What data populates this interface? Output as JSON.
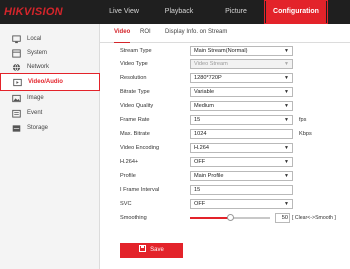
{
  "brand": {
    "logo": "HIKVISION",
    "accent": "#e3232a"
  },
  "nav": {
    "items": [
      {
        "label": "Live View",
        "active": false
      },
      {
        "label": "Playback",
        "active": false
      },
      {
        "label": "Picture",
        "active": false
      },
      {
        "label": "Configuration",
        "active": true
      }
    ]
  },
  "sidebar": {
    "items": [
      {
        "label": "Local",
        "icon": "monitor-icon",
        "active": false
      },
      {
        "label": "System",
        "icon": "system-icon",
        "active": false
      },
      {
        "label": "Network",
        "icon": "globe-icon",
        "active": false
      },
      {
        "label": "Video/Audio",
        "icon": "video-audio-icon",
        "active": true
      },
      {
        "label": "Image",
        "icon": "image-icon",
        "active": false
      },
      {
        "label": "Event",
        "icon": "event-icon",
        "active": false
      },
      {
        "label": "Storage",
        "icon": "storage-icon",
        "active": false
      }
    ]
  },
  "subtabs": [
    {
      "label": "Video",
      "active": true
    },
    {
      "label": "ROI",
      "active": false
    },
    {
      "label": "Display Info. on Stream",
      "active": false
    }
  ],
  "form": {
    "stream_type": {
      "label": "Stream Type",
      "value": "Main Stream(Normal)"
    },
    "video_type": {
      "label": "Video Type",
      "value": "Video Stream",
      "disabled": true
    },
    "resolution": {
      "label": "Resolution",
      "value": "1280*720P"
    },
    "bitrate_type": {
      "label": "Bitrate Type",
      "value": "Variable"
    },
    "video_quality": {
      "label": "Video Quality",
      "value": "Medium"
    },
    "frame_rate": {
      "label": "Frame Rate",
      "value": "15",
      "unit": "fps"
    },
    "max_bitrate": {
      "label": "Max. Bitrate",
      "value": "1024",
      "unit": "Kbps"
    },
    "video_encoding": {
      "label": "Video Encoding",
      "value": "H.264"
    },
    "h264plus": {
      "label": "H.264+",
      "value": "OFF"
    },
    "profile": {
      "label": "Profile",
      "value": "Main Profile"
    },
    "i_frame_interval": {
      "label": "I Frame Interval",
      "value": "15"
    },
    "svc": {
      "label": "SVC",
      "value": "OFF"
    },
    "smoothing": {
      "label": "Smoothing",
      "value": "50",
      "level": 50,
      "hint": "[ Clear<->Smooth ]"
    }
  },
  "save_label": "Save"
}
